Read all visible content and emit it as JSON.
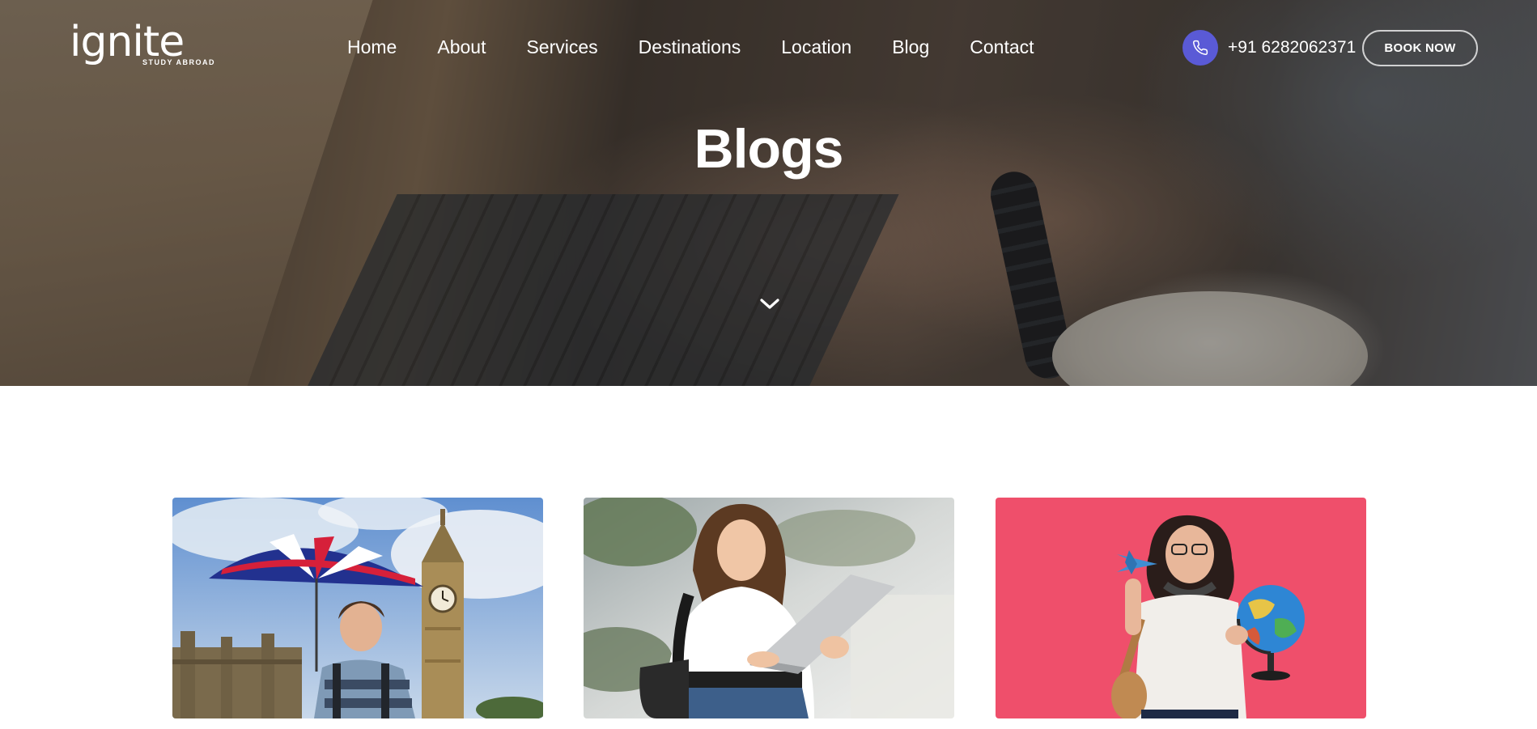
{
  "brand": {
    "name": "Ignite",
    "tagline": "STUDY ABROAD"
  },
  "nav": {
    "items": [
      "Home",
      "About",
      "Services",
      "Destinations",
      "Location",
      "Blog",
      "Contact"
    ]
  },
  "contact": {
    "phone": "+91 6282062371",
    "icon": "phone-icon"
  },
  "cta": {
    "book_label": "BOOK NOW"
  },
  "hero": {
    "title": "Blogs",
    "scroll_icon": "chevron-down-icon"
  },
  "colors": {
    "accent": "#5a5ad6",
    "card3_bg": "#ef4f6b"
  }
}
